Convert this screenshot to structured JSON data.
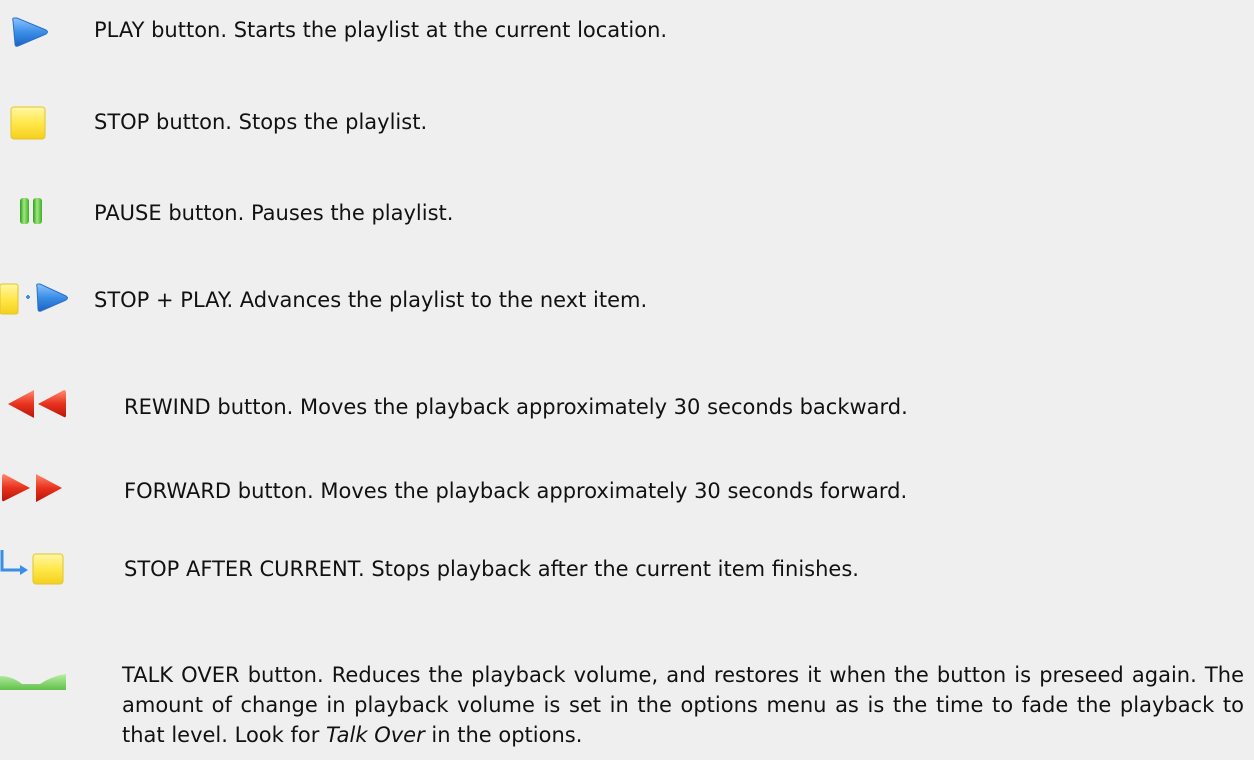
{
  "items": [
    {
      "icon": "play-icon",
      "text": "PLAY button. Starts the playlist at the current location."
    },
    {
      "icon": "stop-icon",
      "text": "STOP button. Stops the playlist."
    },
    {
      "icon": "pause-icon",
      "text": "PAUSE button. Pauses the playlist."
    },
    {
      "icon": "stop-plus-play-icon",
      "text": "STOP + PLAY. Advances the playlist to the next item."
    },
    {
      "icon": "rewind-icon",
      "text": "REWIND button. Moves the playback approximately 30 seconds backward."
    },
    {
      "icon": "forward-icon",
      "text": "FORWARD button. Moves the playback approximately 30 seconds forward."
    },
    {
      "icon": "stop-after-current-icon",
      "text": "STOP AFTER CURRENT. Stops playback after the current item finishes."
    },
    {
      "icon": "talk-over-icon",
      "text_before": "TALK OVER button. Reduces the playback volume, and restores it when the button is preseed again. The amount of change in playback volume is set in the options menu as is the time to fade the playback to that level. Look for ",
      "text_emphasis": "Talk Over",
      "text_after": " in the options."
    }
  ],
  "colors": {
    "background": "#efefef",
    "play_blue": "#3a8ee6",
    "stop_yellow": "#ffe84a",
    "pause_green": "#4cbb2e",
    "rewind_red": "#e8321e",
    "talk_over_green": "#7fd36a"
  }
}
